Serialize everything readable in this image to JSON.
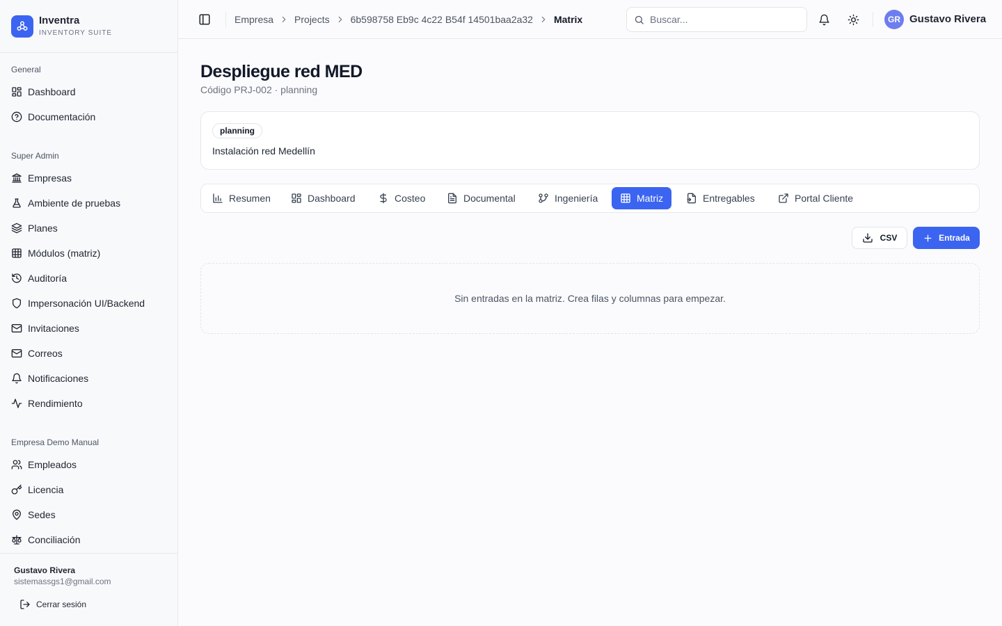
{
  "brand": {
    "name": "Inventra",
    "subtitle": "INVENTORY SUITE",
    "logo_icon": "network-icon",
    "accent_color": "#3b64f0"
  },
  "sidebar": {
    "sections": [
      {
        "title": "General",
        "items": [
          {
            "label": "Dashboard",
            "icon": "grid-icon"
          },
          {
            "label": "Documentación",
            "icon": "help-circle-icon"
          }
        ]
      },
      {
        "title": "Super Admin",
        "items": [
          {
            "label": "Empresas",
            "icon": "library-icon"
          },
          {
            "label": "Ambiente de pruebas",
            "icon": "flask-icon"
          },
          {
            "label": "Planes",
            "icon": "layers-icon"
          },
          {
            "label": "Módulos (matriz)",
            "icon": "table-icon"
          },
          {
            "label": "Auditoría",
            "icon": "history-icon"
          },
          {
            "label": "Impersonación UI/Backend",
            "icon": "shield-icon"
          },
          {
            "label": "Invitaciones",
            "icon": "mail-icon"
          },
          {
            "label": "Correos",
            "icon": "mail-icon"
          },
          {
            "label": "Notificaciones",
            "icon": "bell-icon"
          },
          {
            "label": "Rendimiento",
            "icon": "activity-icon"
          }
        ]
      },
      {
        "title": "Empresa Demo Manual",
        "items": [
          {
            "label": "Empleados",
            "icon": "users-icon"
          },
          {
            "label": "Licencia",
            "icon": "key-icon"
          },
          {
            "label": "Sedes",
            "icon": "map-pin-icon"
          },
          {
            "label": "Conciliación",
            "icon": "scale-icon"
          }
        ]
      }
    ],
    "footer": {
      "user_name": "Gustavo Rivera",
      "user_email": "sistemassgs1@gmail.com",
      "logout_label": "Cerrar sesión"
    }
  },
  "topbar": {
    "breadcrumb": [
      "Empresa",
      "Projects",
      "6b598758 Eb9c 4c22 B54f 14501baa2a32",
      "Matrix"
    ],
    "search_placeholder": "Buscar...",
    "user_initials": "GR",
    "user_name": "Gustavo Rivera"
  },
  "page": {
    "title": "Despliegue red MED",
    "subtitle": "Código PRJ-002 · planning"
  },
  "info_card": {
    "status_badge": "planning",
    "description": "Instalación red Medellín"
  },
  "tabs": [
    {
      "label": "Resumen",
      "icon": "bar-chart-icon",
      "active": false
    },
    {
      "label": "Dashboard",
      "icon": "grid-icon",
      "active": false
    },
    {
      "label": "Costeo",
      "icon": "dollar-icon",
      "active": false
    },
    {
      "label": "Documental",
      "icon": "file-text-icon",
      "active": false
    },
    {
      "label": "Ingeniería",
      "icon": "git-branch-icon",
      "active": false
    },
    {
      "label": "Matriz",
      "icon": "table-icon",
      "active": true
    },
    {
      "label": "Entregables",
      "icon": "file-export-icon",
      "active": false
    },
    {
      "label": "Portal Cliente",
      "icon": "external-link-icon",
      "active": false
    }
  ],
  "toolbar": {
    "csv_label": "CSV",
    "new_entry_label": "Entrada"
  },
  "matrix": {
    "empty_message": "Sin entradas en la matriz. Crea filas y columnas para empezar."
  }
}
